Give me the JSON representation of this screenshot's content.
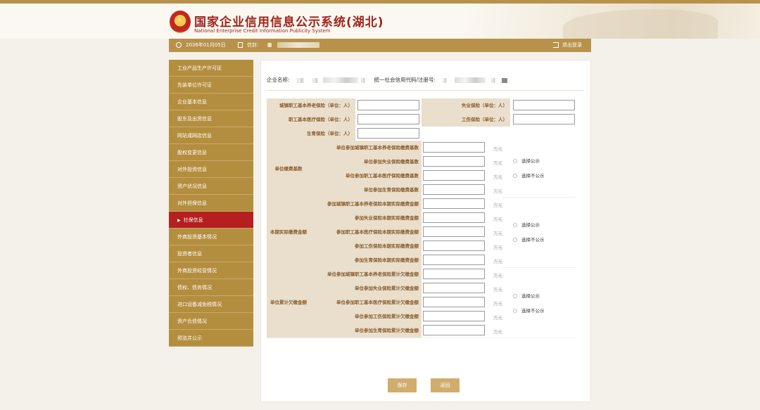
{
  "header": {
    "title": "国家企业信用信息公示系统(湖北)",
    "subtitle": "National Enterprise Credit Information Publicity System"
  },
  "infobar": {
    "date": "2036年01月05日",
    "info_prefix": "信封:",
    "logout": "退出登录"
  },
  "sidebar": {
    "items": [
      {
        "label": "工业产品生产许可证"
      },
      {
        "label": "先装单位许可证"
      },
      {
        "label": "企业基本信息"
      },
      {
        "label": "股东及出资信息"
      },
      {
        "label": "网站或网店信息"
      },
      {
        "label": "股权变更信息"
      },
      {
        "label": "对外投资信息"
      },
      {
        "label": "资产状况信息"
      },
      {
        "label": "对外担保信息"
      },
      {
        "label": "社保信息"
      },
      {
        "label": "外商投资基本情况"
      },
      {
        "label": "投资者信息"
      },
      {
        "label": "外商投资经营情况"
      },
      {
        "label": "债权、债务情况"
      },
      {
        "label": "进口设备减免税情况"
      },
      {
        "label": "资产负债情况"
      },
      {
        "label": "预览并公示"
      }
    ],
    "active_index": 9
  },
  "enterprise": {
    "name_label": "企业名称:",
    "code_label": "统一社会信用代码/注册号:"
  },
  "insurance": {
    "fields_left": [
      {
        "label": "城镇职工基本养老保险（单位：人）"
      },
      {
        "label": "职工基本医疗保险（单位：人）"
      },
      {
        "label": "生育保险（单位：人）"
      }
    ],
    "fields_right": [
      {
        "label": "失业保险（单位：人）"
      },
      {
        "label": "工伤保险（单位：人）"
      }
    ]
  },
  "groups": [
    {
      "label": "单位缴费基数",
      "rows": [
        {
          "label": "单位参加城镇职工基本养老保险缴费基数",
          "unit": "万元"
        },
        {
          "label": "单位参加失业保险缴费基数",
          "unit": "万元"
        },
        {
          "label": "单位参加职工基本医疗保险缴费基数",
          "unit": "万元"
        },
        {
          "label": "单位参加生育保险缴费基数",
          "unit": "万元"
        }
      ],
      "publish": "选择公示",
      "no_publish": "选择不公示"
    },
    {
      "label": "本期实际缴费金额",
      "rows": [
        {
          "label": "参加城镇职工基本养老保险本期实际缴费金额",
          "unit": "万元"
        },
        {
          "label": "参加失业保险本期实际缴费金额",
          "unit": "万元"
        },
        {
          "label": "参加职工基本医疗保险本期实际缴费金额",
          "unit": "万元"
        },
        {
          "label": "参加工伤保险本期实际缴费金额",
          "unit": "万元"
        },
        {
          "label": "参加生育保险本期实际缴费金额",
          "unit": "万元"
        }
      ],
      "publish": "选择公示",
      "no_publish": "选择不公示"
    },
    {
      "label": "单位累计欠缴金额",
      "rows": [
        {
          "label": "单位参加城镇职工基本养老保险累计欠缴金额",
          "unit": "万元"
        },
        {
          "label": "单位参加失业保险累计欠缴金额",
          "unit": "万元"
        },
        {
          "label": "单位参加职工基本医疗保险累计欠缴金额",
          "unit": "万元"
        },
        {
          "label": "单位参加工伤保险累计欠缴金额",
          "unit": "万元"
        },
        {
          "label": "单位参加生育保险累计欠缴金额",
          "unit": "万元"
        }
      ],
      "publish": "选择公示",
      "no_publish": "选择不公示"
    }
  ],
  "buttons": {
    "save": "保存",
    "back": "返回"
  },
  "colors": {
    "gold": "#b8924a",
    "sidebar": "#b48e3f",
    "active": "#b51f1f",
    "label_bg": "#e9dfcc",
    "button": "#d1ad6d"
  }
}
